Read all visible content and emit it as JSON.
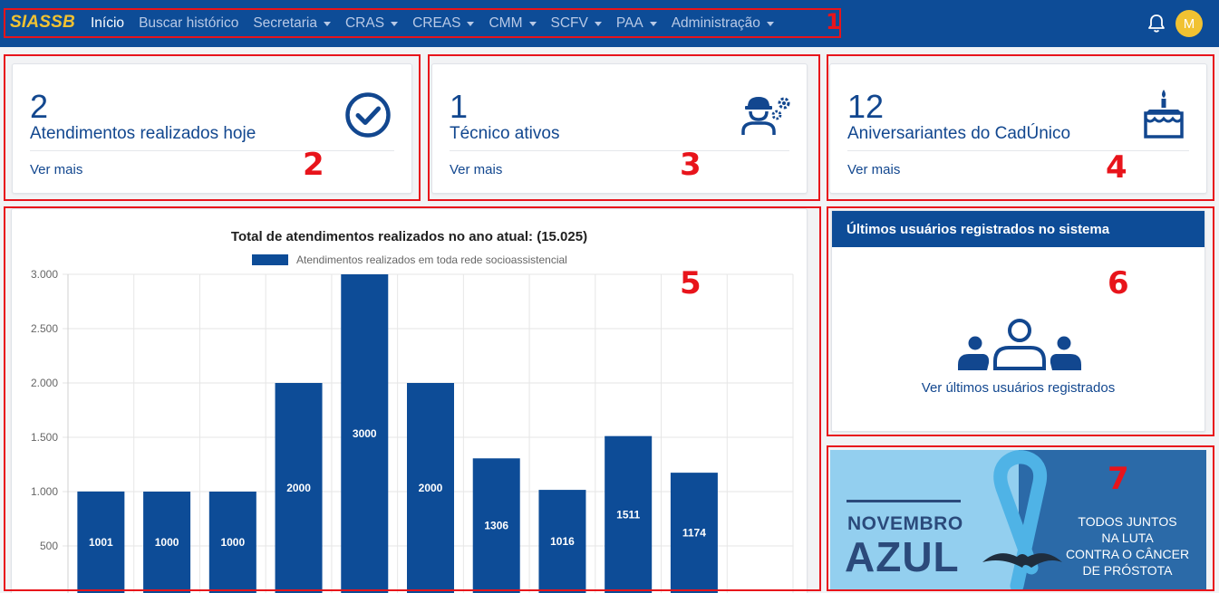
{
  "nav": {
    "brand": "SIASSB",
    "items": [
      {
        "label": "Início",
        "active": true,
        "dropdown": false
      },
      {
        "label": "Buscar histórico",
        "active": false,
        "dropdown": false
      },
      {
        "label": "Secretaria",
        "active": false,
        "dropdown": true
      },
      {
        "label": "CRAS",
        "active": false,
        "dropdown": true
      },
      {
        "label": "CREAS",
        "active": false,
        "dropdown": true
      },
      {
        "label": "CMM",
        "active": false,
        "dropdown": true
      },
      {
        "label": "SCFV",
        "active": false,
        "dropdown": true
      },
      {
        "label": "PAA",
        "active": false,
        "dropdown": true
      },
      {
        "label": "Administração",
        "active": false,
        "dropdown": true
      }
    ],
    "notification_icon": "bell-icon",
    "avatar_initial": "M"
  },
  "stats": [
    {
      "value": "2",
      "label": "Atendimentos realizados hoje",
      "link": "Ver mais",
      "icon": "check-circle-icon"
    },
    {
      "value": "1",
      "label": "Técnico ativos",
      "link": "Ver mais",
      "icon": "engineer-gears-icon"
    },
    {
      "value": "12",
      "label": "Aniversariantes do CadÚnico",
      "link": "Ver mais",
      "icon": "birthday-cake-icon"
    }
  ],
  "chart_data": {
    "type": "bar",
    "title": "Total de atendimentos realizados no ano atual: (15.025)",
    "legend": "Atendimentos realizados em toda rede socioassistencial",
    "legend_placement": "top",
    "series": [
      {
        "name": "Atendimentos realizados em toda rede socioassistencial",
        "values": [
          1001,
          1000,
          1000,
          2000,
          3000,
          2000,
          1306,
          1016,
          1511,
          1174,
          null
        ],
        "color": "#0d4c97"
      }
    ],
    "ylim": [
      0,
      3000
    ],
    "y_ticks": [
      "500",
      "1.000",
      "1.500",
      "2.000",
      "2.500",
      "3.000"
    ],
    "grid": true
  },
  "users": {
    "header": "Últimos usuários registrados no sistema",
    "icon": "users-group-icon",
    "link": "Ver últimos usuários registrados"
  },
  "banner": {
    "title_line1": "NOVEMBRO",
    "title_line2": "AZUL",
    "campaign_text": "TODOS JUNTOS\nNA LUTA\nCONTRA O CÂNCER\nDE PRÓSTOTA",
    "icon": "blue-ribbon-mustache-icon",
    "colors": {
      "left": "#93cfef",
      "right": "#2b6aa8",
      "text": "#2b4a7b"
    }
  },
  "annotations": [
    "1",
    "2",
    "3",
    "4",
    "5",
    "6",
    "7"
  ],
  "colors": {
    "primary": "#0d4c97",
    "accent": "#f1c232",
    "annotation": "#e8141b"
  }
}
